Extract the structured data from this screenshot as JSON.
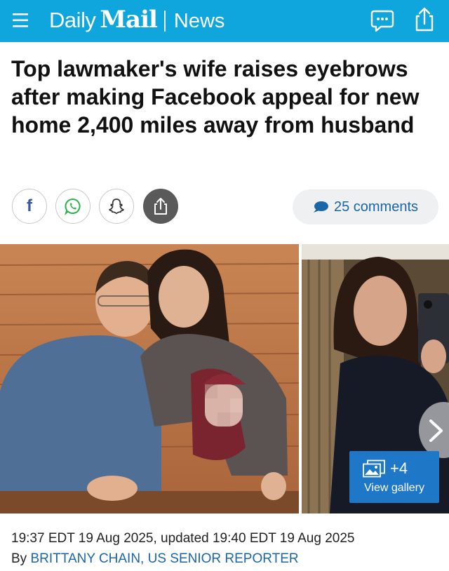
{
  "header": {
    "brand_daily": "Daily",
    "brand_mail": "Mail",
    "section": "News",
    "colors": {
      "bar": "#0ea6dc"
    },
    "icons": [
      "menu-icon",
      "comments-icon",
      "share-icon"
    ]
  },
  "article": {
    "headline": "Top lawmaker's wife raises eyebrows after making Facebook appeal for new home 2,400 miles away from husband",
    "share_icons": [
      "facebook-icon",
      "whatsapp-icon",
      "snapchat-icon",
      "share-icon"
    ],
    "comments_count": "25 comments",
    "gallery_count": "+4",
    "gallery_label": "View gallery",
    "timestamp": "19:37 EDT 19 Aug 2025, updated 19:40 EDT 19 Aug 2025",
    "byline_prefix": "By",
    "author": "BRITTANY CHAIN, US SENIOR REPORTER",
    "colors": {
      "link": "#1a66a8",
      "gallery": "#1f77c8"
    }
  }
}
